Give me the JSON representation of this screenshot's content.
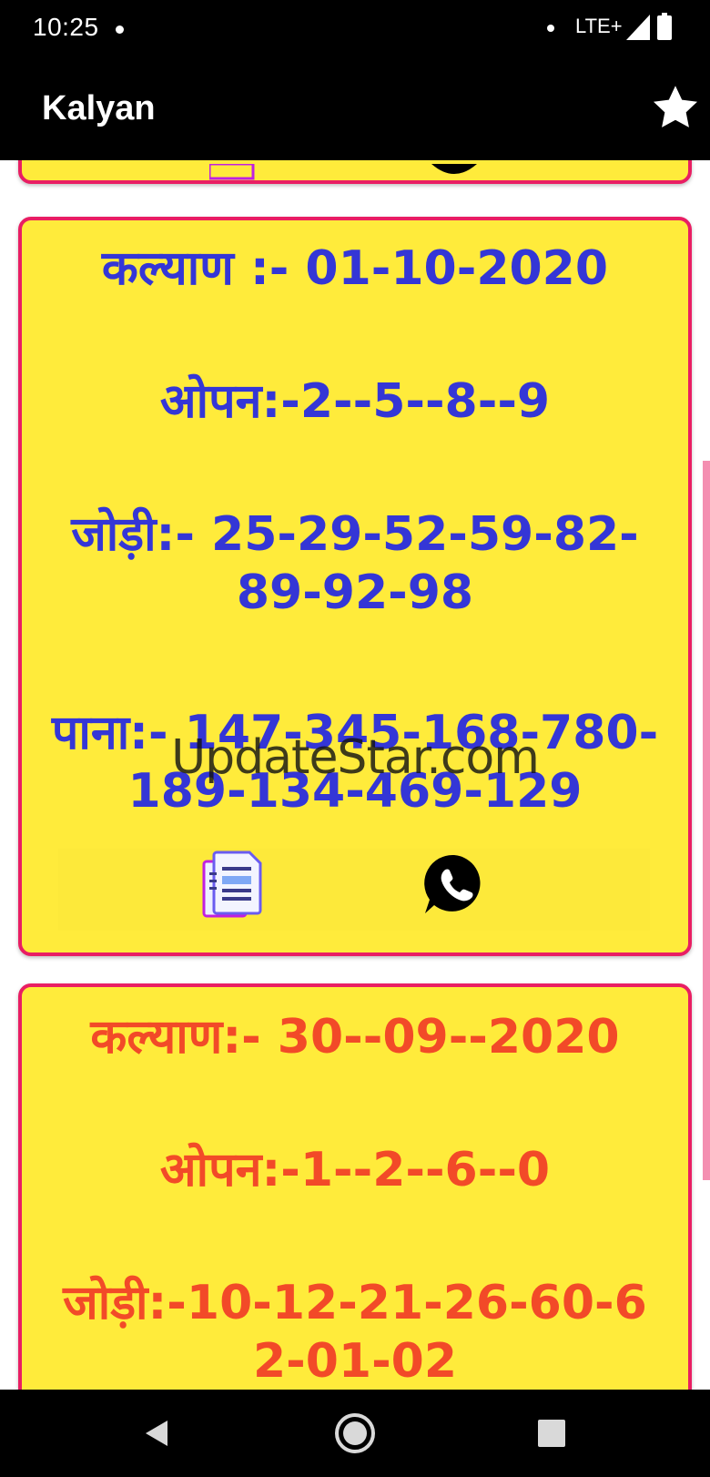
{
  "status_bar": {
    "time": "10:25",
    "network": "LTE+",
    "icons": [
      "notification-dot-icon",
      "signal-icon",
      "battery-icon"
    ]
  },
  "app_bar": {
    "title": "Kalyan",
    "favorite_icon": "star-icon"
  },
  "cards": [
    {
      "title": "कल्याण :- 01-10-2020",
      "open": "ओपन:-2--5--8--9",
      "jodi_line1": "जोड़ी:- 25-29-52-59-82-",
      "jodi_line2": "89-92-98",
      "pana_line1": "पाना:- 147-345-168-780-",
      "pana_line2": "189-134-469-129",
      "watermark": "UpdateStar.com",
      "actions": [
        "copy-icon",
        "whatsapp-icon"
      ],
      "text_color": "#3436d6"
    },
    {
      "title": "कल्याण:- 30--09--2020",
      "open": "ओपन:-1--2--6--0",
      "jodi_line1": "जोड़ी:-10-12-21-26-60-6",
      "jodi_line2": "2-01-02",
      "text_color": "#f24a28"
    }
  ],
  "colors": {
    "card_background": "#ffeb3b",
    "card_border": "#e91e63",
    "bar_background": "#000000",
    "scroll_indicator": "#f48fb1"
  },
  "nav_bar": {
    "buttons": [
      "back-icon",
      "home-icon",
      "recents-icon"
    ]
  }
}
